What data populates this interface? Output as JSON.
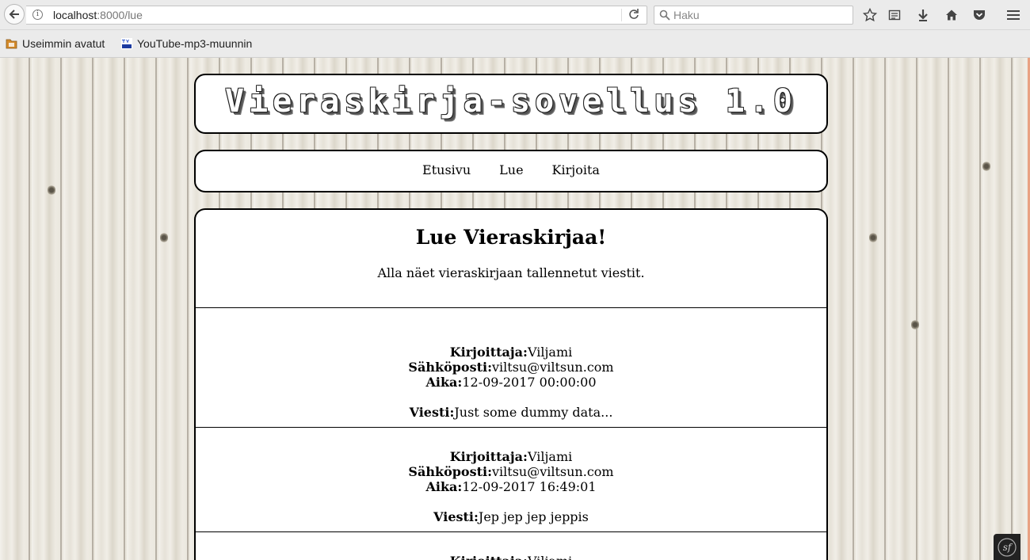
{
  "browser": {
    "url_host": "localhost",
    "url_rest": ":8000/lue",
    "search_placeholder": "Haku",
    "bookmarks": [
      {
        "label": "Useimmin avatut",
        "icon": "folder-icon"
      },
      {
        "label": "YouTube-mp3-muunnin",
        "icon": "yt-mp3-icon"
      }
    ]
  },
  "page": {
    "app_title": "Vieraskirja-sovellus 1.0",
    "nav": [
      "Etusivu",
      "Lue",
      "Kirjoita"
    ],
    "heading": "Lue Vieraskirjaa!",
    "subtitle": "Alla näet vieraskirjaan tallennetut viestit.",
    "labels": {
      "author": "Kirjoittaja:",
      "email": "Sähköposti:",
      "time": "Aika:",
      "message": "Viesti:"
    },
    "entries": [
      {
        "author": "Viljami",
        "email": "viltsu@viltsun.com",
        "time": "12-09-2017 00:00:00",
        "message": "Just some dummy data..."
      },
      {
        "author": "Viljami",
        "email": "viltsu@viltsun.com",
        "time": "12-09-2017 16:49:01",
        "message": "Jep jep jep jeppis"
      },
      {
        "author": "Viljami"
      }
    ]
  },
  "colors": {
    "accent_scroll": "#e9a182",
    "panel_border": "#000000"
  }
}
